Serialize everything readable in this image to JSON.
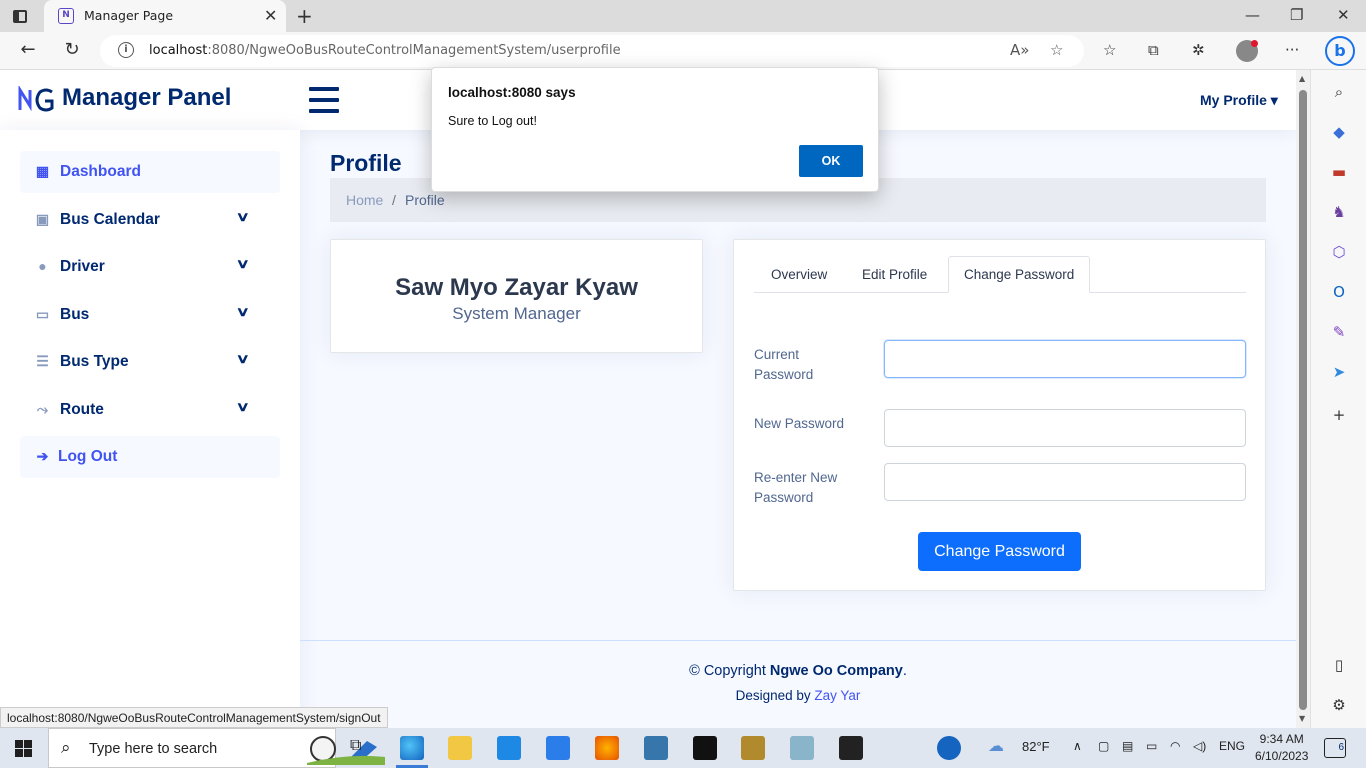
{
  "browser": {
    "tab_title": "Manager Page",
    "url_host": "localhost",
    "url_rest": ":8080/NgweOoBusRouteControlManagementSystem/userprofile",
    "status_url": "localhost:8080/NgweOoBusRouteControlManagementSystem/signOut"
  },
  "header": {
    "logo_text": "Manager Panel",
    "profile_menu": "My Profile ▾"
  },
  "sidebar": {
    "items": [
      {
        "label": "Dashboard",
        "icon": "grid-icon"
      },
      {
        "label": "Bus Calendar",
        "icon": "calendar-icon"
      },
      {
        "label": "Driver",
        "icon": "people-icon"
      },
      {
        "label": "Bus",
        "icon": "bus-icon"
      },
      {
        "label": "Bus Type",
        "icon": "list-icon"
      },
      {
        "label": "Route",
        "icon": "route-icon"
      },
      {
        "label": "Log Out",
        "icon": "arrow-right-icon"
      }
    ]
  },
  "main": {
    "title": "Profile",
    "breadcrumb": {
      "home": "Home",
      "separator": "/",
      "current": "Profile"
    },
    "profile": {
      "name": "Saw Myo Zayar Kyaw",
      "role": "System Manager"
    },
    "tabs": [
      "Overview",
      "Edit Profile",
      "Change Password"
    ],
    "active_tab": "Change Password",
    "form": {
      "current_password_label_1": "Current",
      "current_password_label_2": "Password",
      "new_password_label": "New Password",
      "reenter_label_1": "Re-enter New",
      "reenter_label_2": "Password",
      "submit": "Change Password"
    }
  },
  "footer": {
    "copyright_prefix": "© Copyright ",
    "company": "Ngwe Oo Company",
    "copyright_suffix": ".",
    "designed_by": "Designed by ",
    "designer": "Zay Yar"
  },
  "dialog": {
    "title": "localhost:8080 says",
    "message": "Sure to Log out!",
    "ok": "OK"
  },
  "taskbar": {
    "search_placeholder": "Type here to search",
    "temperature": "82°F",
    "language": "ENG",
    "time": "9:34 AM",
    "date": "6/10/2023",
    "notifications": "6"
  },
  "colors": {
    "brand_navy": "#012970",
    "accent_blue": "#4154f1",
    "primary_button": "#0d6efd",
    "dialog_ok": "#0067c0"
  }
}
